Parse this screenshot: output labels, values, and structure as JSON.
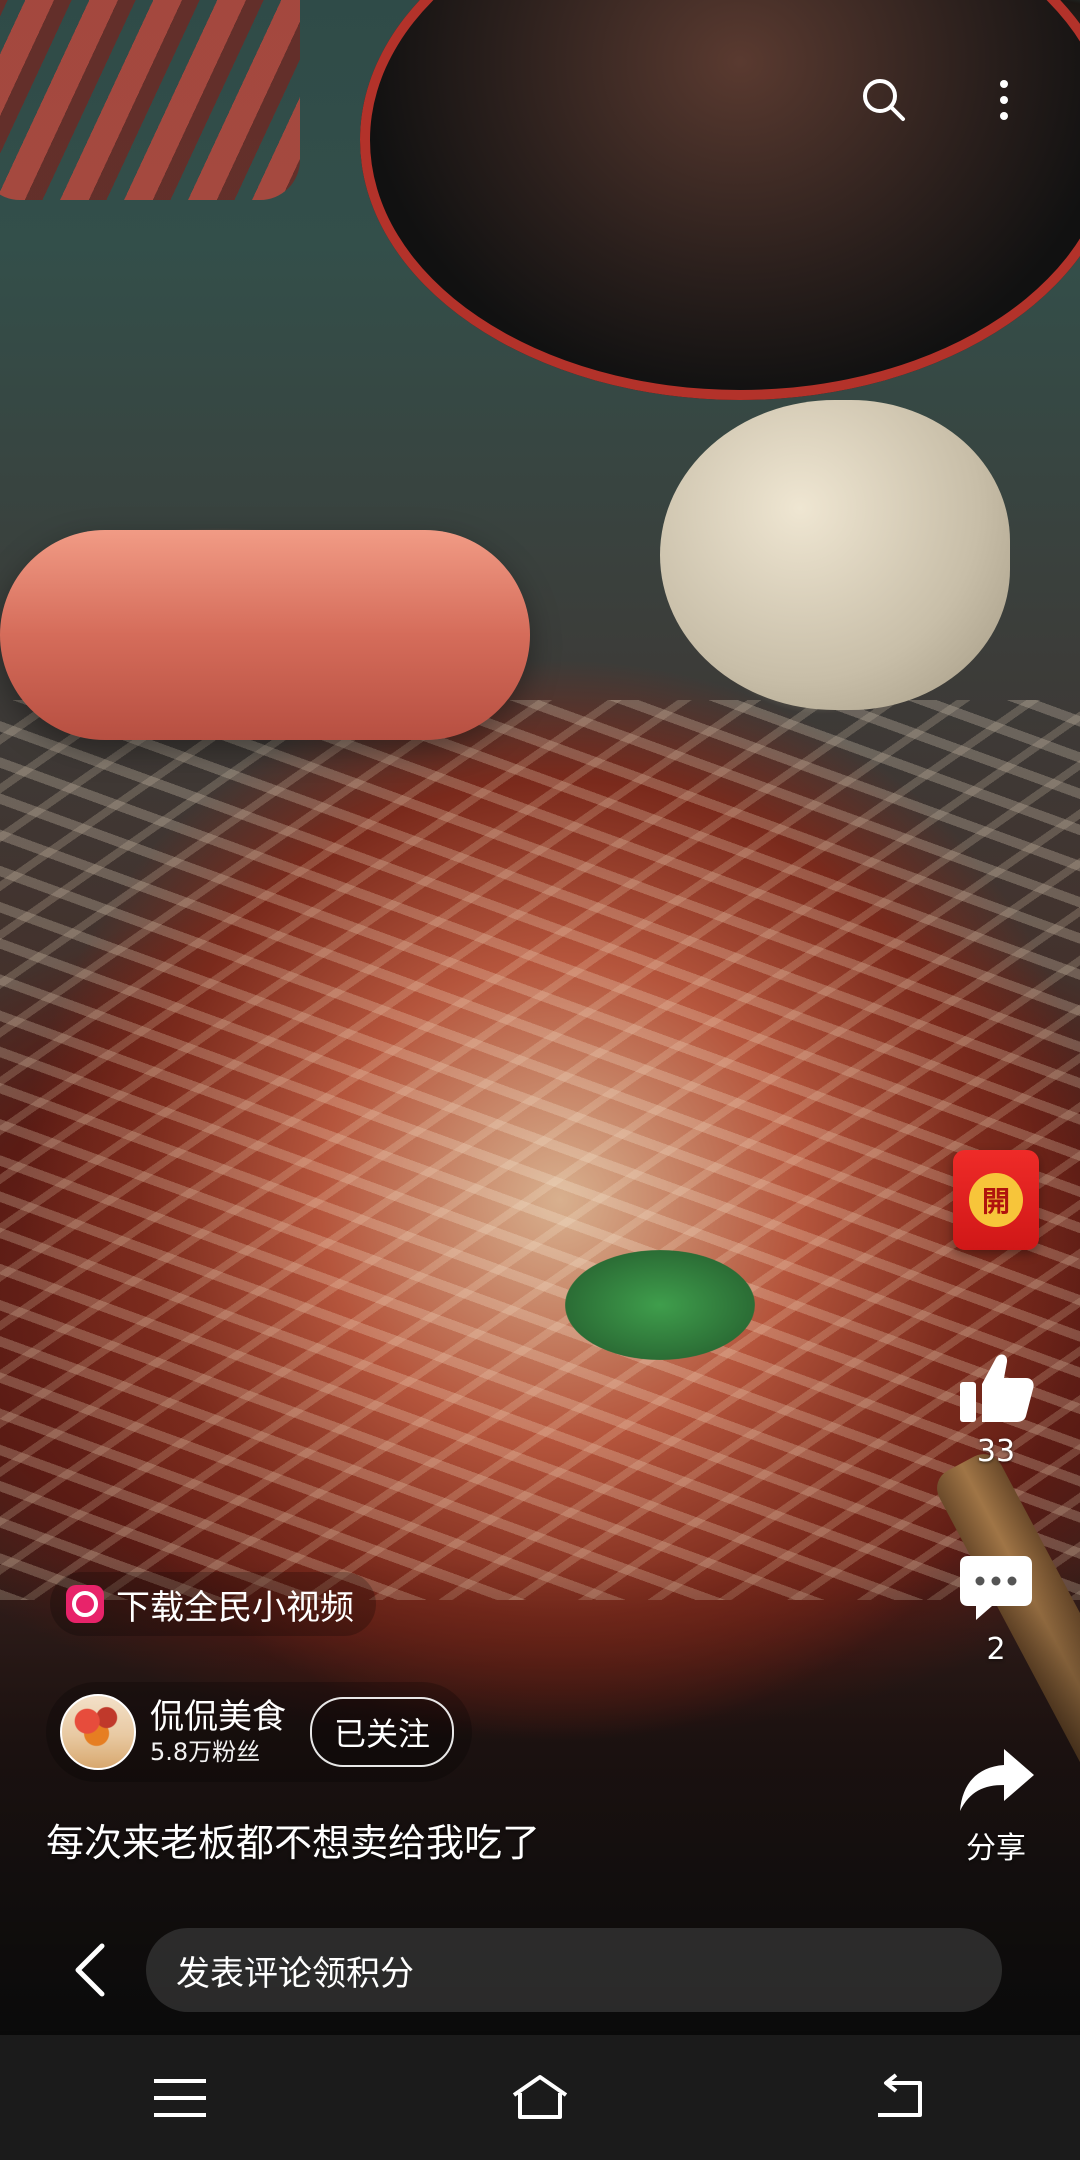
{
  "top_bar": {
    "search_icon": "search-icon",
    "more_icon": "more-vertical-icon"
  },
  "side_actions": {
    "redpack_label": "開",
    "like_count": "33",
    "comment_count": "2",
    "share_label": "分享"
  },
  "download_chip": {
    "label": "下载全民小视频"
  },
  "author": {
    "name": "侃侃美食",
    "fans": "5.8万粉丝",
    "follow_label": "已关注"
  },
  "caption": "每次来老板都不想卖给我吃了",
  "comment_bar": {
    "placeholder": "发表评论领积分"
  },
  "nav": {
    "menu_icon": "menu-icon",
    "home_icon": "home-icon",
    "back_icon": "back-icon"
  },
  "colors": {
    "redpack": "#d01717",
    "coin": "#f7c53a",
    "app_logo": "#e8236a",
    "navbar": "#1b1b1b"
  }
}
